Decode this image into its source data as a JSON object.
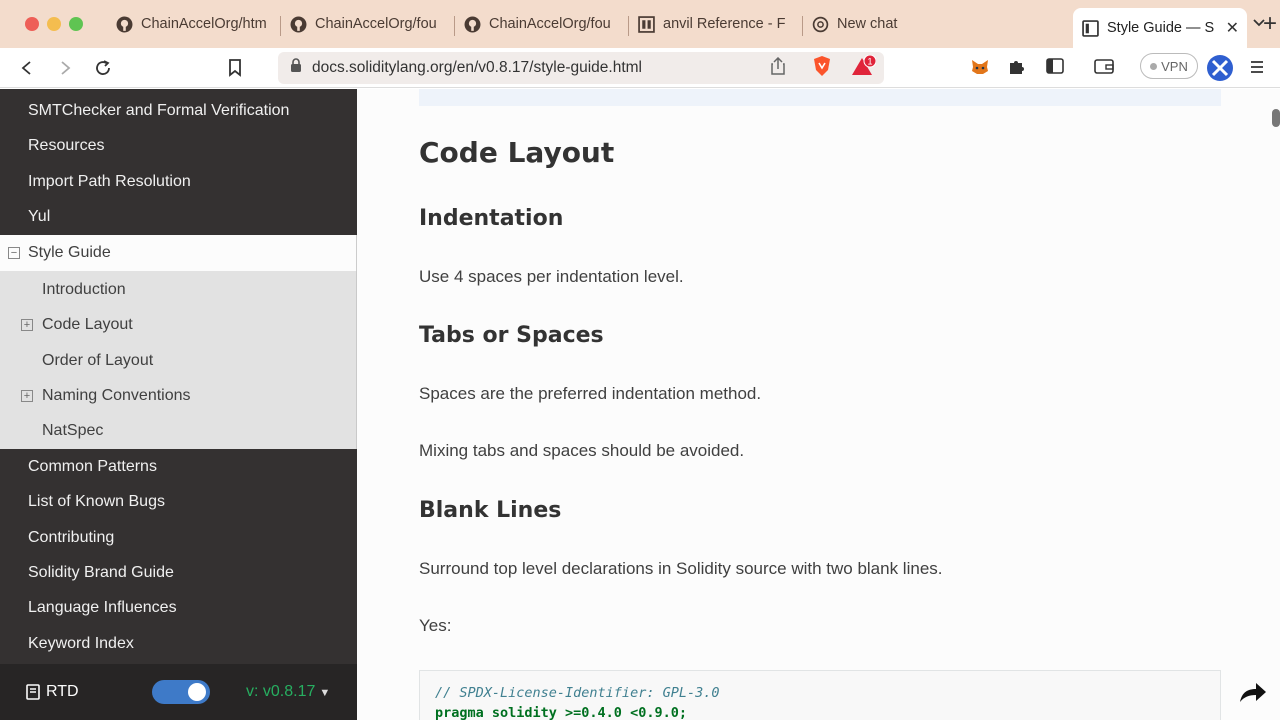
{
  "browser": {
    "tabs": [
      {
        "title": "ChainAccelOrg/htm",
        "icon": "github-icon"
      },
      {
        "title": "ChainAccelOrg/fou",
        "icon": "github-icon"
      },
      {
        "title": "ChainAccelOrg/fou",
        "icon": "github-icon"
      },
      {
        "title": "anvil Reference - F",
        "icon": "book-icon"
      },
      {
        "title": "New chat",
        "icon": "openai-icon"
      },
      {
        "title": "Style Guide — S",
        "icon": "docs-icon",
        "active": true
      }
    ],
    "url": "docs.soliditylang.org/en/v0.8.17/style-guide.html",
    "vpn_label": "VPN",
    "bat_badge": "1"
  },
  "sidebar": {
    "items_top": [
      "SMTChecker and Formal Verification",
      "Resources",
      "Import Path Resolution",
      "Yul"
    ],
    "current": "Style Guide",
    "sub_items": [
      {
        "label": "Introduction",
        "expandable": false
      },
      {
        "label": "Code Layout",
        "expandable": true
      },
      {
        "label": "Order of Layout",
        "expandable": false
      },
      {
        "label": "Naming Conventions",
        "expandable": true
      },
      {
        "label": "NatSpec",
        "expandable": false
      }
    ],
    "items_bottom": [
      "Common Patterns",
      "List of Known Bugs",
      "Contributing",
      "Solidity Brand Guide",
      "Language Influences",
      "Keyword Index"
    ],
    "rtd_label": "RTD",
    "version": "v: v0.8.17"
  },
  "content": {
    "h1": "Code Layout",
    "indentation_heading": "Indentation",
    "indentation_text": "Use 4 spaces per indentation level.",
    "tabs_heading": "Tabs or Spaces",
    "tabs_text1": "Spaces are the preferred indentation method.",
    "tabs_text2": "Mixing tabs and spaces should be avoided.",
    "blank_heading": "Blank Lines",
    "blank_text": "Surround top level declarations in Solidity source with two blank lines.",
    "yes_label": "Yes:",
    "code_line1": "// SPDX-License-Identifier: GPL-3.0",
    "code_line2": "pragma solidity >=0.4.0 <0.9.0;"
  },
  "colors": {
    "tabbar": "#f3dccc",
    "sidebar": "#343131",
    "accent": "#3e7ac8",
    "version_green": "#27ae60"
  }
}
